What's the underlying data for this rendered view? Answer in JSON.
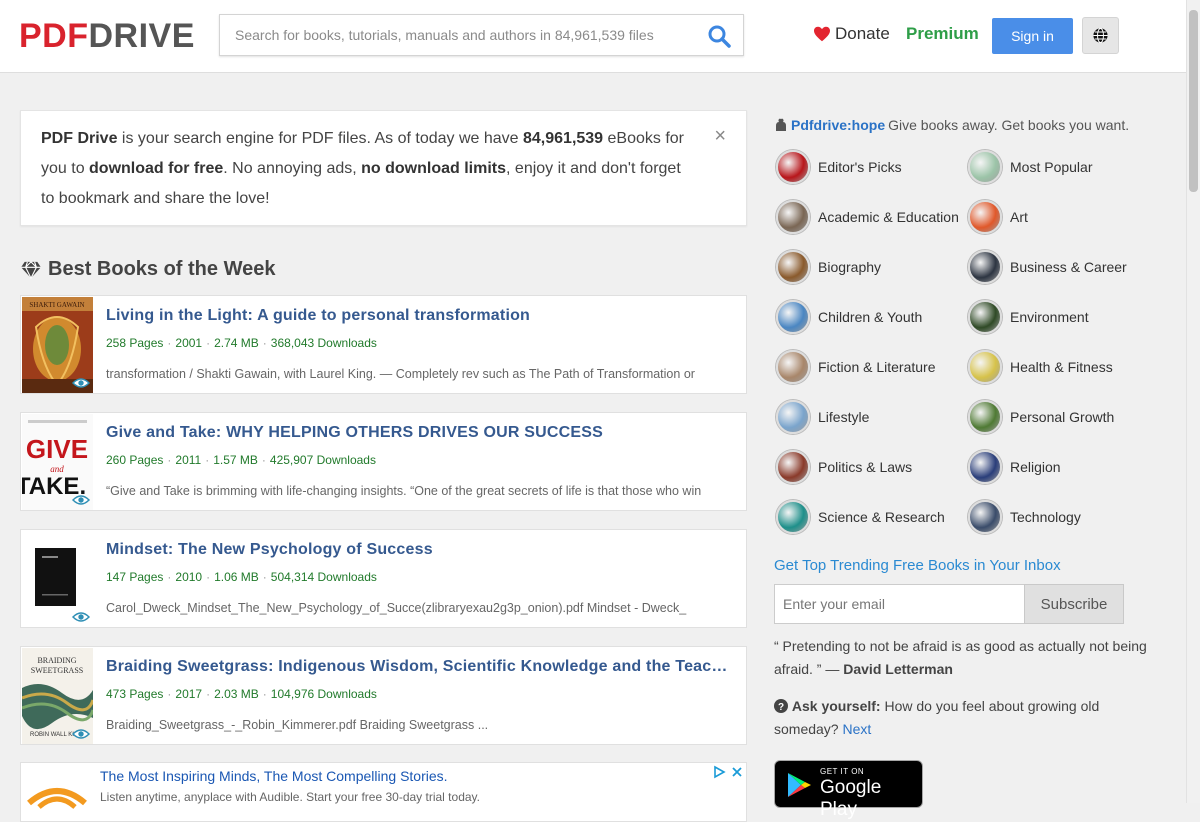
{
  "header": {
    "logo_pdf": "PDF",
    "logo_drive": "DRIVE",
    "search_placeholder": "Search for books, tutorials, manuals and authors in 84,961,539 files",
    "donate_label": "Donate",
    "premium_label": "Premium",
    "signin_label": "Sign in"
  },
  "notice": {
    "brand": "PDF Drive",
    "t1": " is your search engine for PDF files. As of today we have ",
    "count": "84,961,539",
    "t2": " eBooks for you to ",
    "free": "download for free",
    "t3": ". No annoying ads, ",
    "limits": "no download limits",
    "t4": ", enjoy it and don't forget to bookmark and share the love!",
    "close": "×"
  },
  "section_title": "Best Books of the Week",
  "books": [
    {
      "title": "Living in the Light: A guide to personal transformation",
      "pages": "258 Pages",
      "year": "2001",
      "size": "2.74 MB",
      "downloads": "368,043 Downloads",
      "snippet": "transformation / Shakti Gawain, with Laurel King. — Completely rev such as The Path of Transformation or"
    },
    {
      "title": "Give and Take: WHY HELPING OTHERS DRIVES OUR SUCCESS",
      "pages": "260 Pages",
      "year": "2011",
      "size": "1.57 MB",
      "downloads": "425,907 Downloads",
      "snippet": "“Give and Take is brimming with life-changing insights. “One of the great secrets of life is that those who win"
    },
    {
      "title": "Mindset: The New Psychology of Success",
      "pages": "147 Pages",
      "year": "2010",
      "size": "1.06 MB",
      "downloads": "504,314 Downloads",
      "snippet": "Carol_Dweck_Mindset_The_New_Psychology_of_Succe(zlibraryexau2g3p_onion).pdf Mindset - Dweck_"
    },
    {
      "title": "Braiding Sweetgrass: Indigenous Wisdom, Scientific Knowledge and the Teachings of Plants",
      "pages": "473 Pages",
      "year": "2017",
      "size": "2.03 MB",
      "downloads": "104,976 Downloads",
      "snippet": "Braiding_Sweetgrass_-_Robin_Kimmerer.pdf Braiding Sweetgrass  ..."
    }
  ],
  "ad": {
    "title": "The Most Inspiring Minds, The Most Compelling Stories.",
    "text": "Listen anytime, anyplace with Audible. Start your free 30-day trial today."
  },
  "sidebar": {
    "hope_link": "Pdfdrive:hope",
    "hope_text": " Give books away. Get books you want.",
    "categories": [
      {
        "label": "Editor's Picks",
        "color": "#b8161b"
      },
      {
        "label": "Most Popular",
        "color": "#9cc4a8"
      },
      {
        "label": "Academic & Education",
        "color": "#7a6654"
      },
      {
        "label": "Art",
        "color": "#e0582a"
      },
      {
        "label": "Biography",
        "color": "#8a5a2c"
      },
      {
        "label": "Business & Career",
        "color": "#2d3542"
      },
      {
        "label": "Children & Youth",
        "color": "#4a86c2"
      },
      {
        "label": "Environment",
        "color": "#2f4a26"
      },
      {
        "label": "Fiction & Literature",
        "color": "#a8866a"
      },
      {
        "label": "Health & Fitness",
        "color": "#d6c24a"
      },
      {
        "label": "Lifestyle",
        "color": "#7aa4cc"
      },
      {
        "label": "Personal Growth",
        "color": "#4f7a34"
      },
      {
        "label": "Politics & Laws",
        "color": "#8a3a2a"
      },
      {
        "label": "Religion",
        "color": "#2a3e7a"
      },
      {
        "label": "Science & Research",
        "color": "#1e8f8a"
      },
      {
        "label": "Technology",
        "color": "#3a4c6a"
      }
    ],
    "trend_title": "Get Top Trending Free Books in Your Inbox",
    "email_placeholder": "Enter your email",
    "subscribe_label": "Subscribe",
    "quote_text": "“ Pretending to not be afraid is as good as actually not being afraid. ” — ",
    "quote_author": "David Letterman",
    "ask_label": "Ask yourself:",
    "ask_text": " How do you feel about growing old someday? ",
    "ask_next": "Next",
    "gplay_small": "GET IT ON",
    "gplay_big": "Google Play"
  },
  "colors": {
    "brand_red": "#d9232d",
    "premium_green": "#2e9e48",
    "signin_blue": "#4a8ee8",
    "title_blue": "#35598f",
    "meta_green": "#217a2b"
  }
}
